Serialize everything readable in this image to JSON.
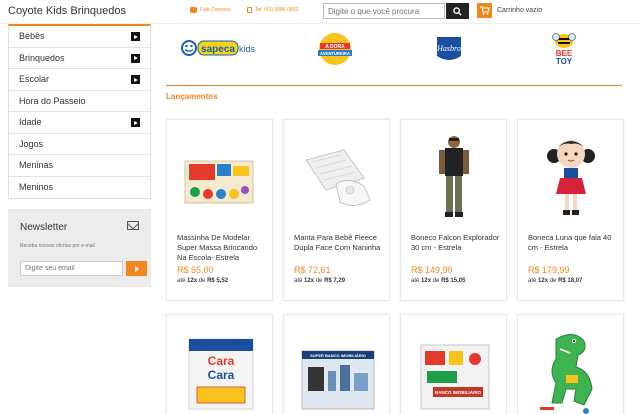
{
  "header": {
    "store_name": "Coyote Kids Brinquedos",
    "chat_label": "Fale Conosco",
    "phone_label": "Tel. (41) 3086-0803",
    "search_placeholder": "Digite o que você procura",
    "cart_label": "Carrinho vazio"
  },
  "sidebar": {
    "items": [
      {
        "label": "Bebês",
        "has_arrow": true
      },
      {
        "label": "Brinquedos",
        "has_arrow": true
      },
      {
        "label": "Escolar",
        "has_arrow": true
      },
      {
        "label": "Hora do Passeio",
        "has_arrow": false
      },
      {
        "label": "Idade",
        "has_arrow": true
      },
      {
        "label": "Jogos",
        "has_arrow": false
      },
      {
        "label": "Meninas",
        "has_arrow": false
      },
      {
        "label": "Meninos",
        "has_arrow": false
      }
    ]
  },
  "newsletter": {
    "title": "Newsletter",
    "description": "Receba nossas ofertas por e-mail",
    "email_placeholder": "Digite seu email"
  },
  "brands": {
    "sapeca": "sapeca",
    "sapeca_suffix": "kids",
    "adora": "A DORA",
    "adora_sub": "AVENTUREIRA",
    "hasbro": "Hasbro",
    "bee_top": "BEE",
    "bee_bottom": "TOY"
  },
  "main": {
    "section_title": "Lançamentos",
    "products": [
      {
        "name": "Massinha De Modelar Super Massa Brincando Na Escola- Estrela",
        "price": "R$ 55,00",
        "installment_prefix": "até",
        "installment_count": "12x",
        "installment_mid": "de",
        "installment_value": "R$ 5,52"
      },
      {
        "name": "Manta Para Bebê Fleece Dupla Face Com Naninha",
        "price": "R$ 72,61",
        "installment_prefix": "até",
        "installment_count": "12x",
        "installment_mid": "de",
        "installment_value": "R$ 7,29"
      },
      {
        "name": "Boneco Falcon Explorador 30 cm - Estrela",
        "price": "R$ 149,90",
        "installment_prefix": "até",
        "installment_count": "12x",
        "installment_mid": "de",
        "installment_value": "R$ 15,05"
      },
      {
        "name": "Boneca Luna que fala 40 cm - Estrela",
        "price": "R$ 179,99",
        "installment_prefix": "até",
        "installment_count": "12x",
        "installment_mid": "de",
        "installment_value": "R$ 18,07"
      }
    ],
    "row2": {
      "cara_top": "Cara",
      "cara_bottom": "Cara",
      "sbm_label": "SUPER BANCO IMOBILIÁRIO",
      "bm_label": "BANCO IMOBILIÁRIO"
    }
  },
  "colors": {
    "accent": "#f0871e",
    "dark": "#222222",
    "sidebar_bg": "#ececec"
  }
}
